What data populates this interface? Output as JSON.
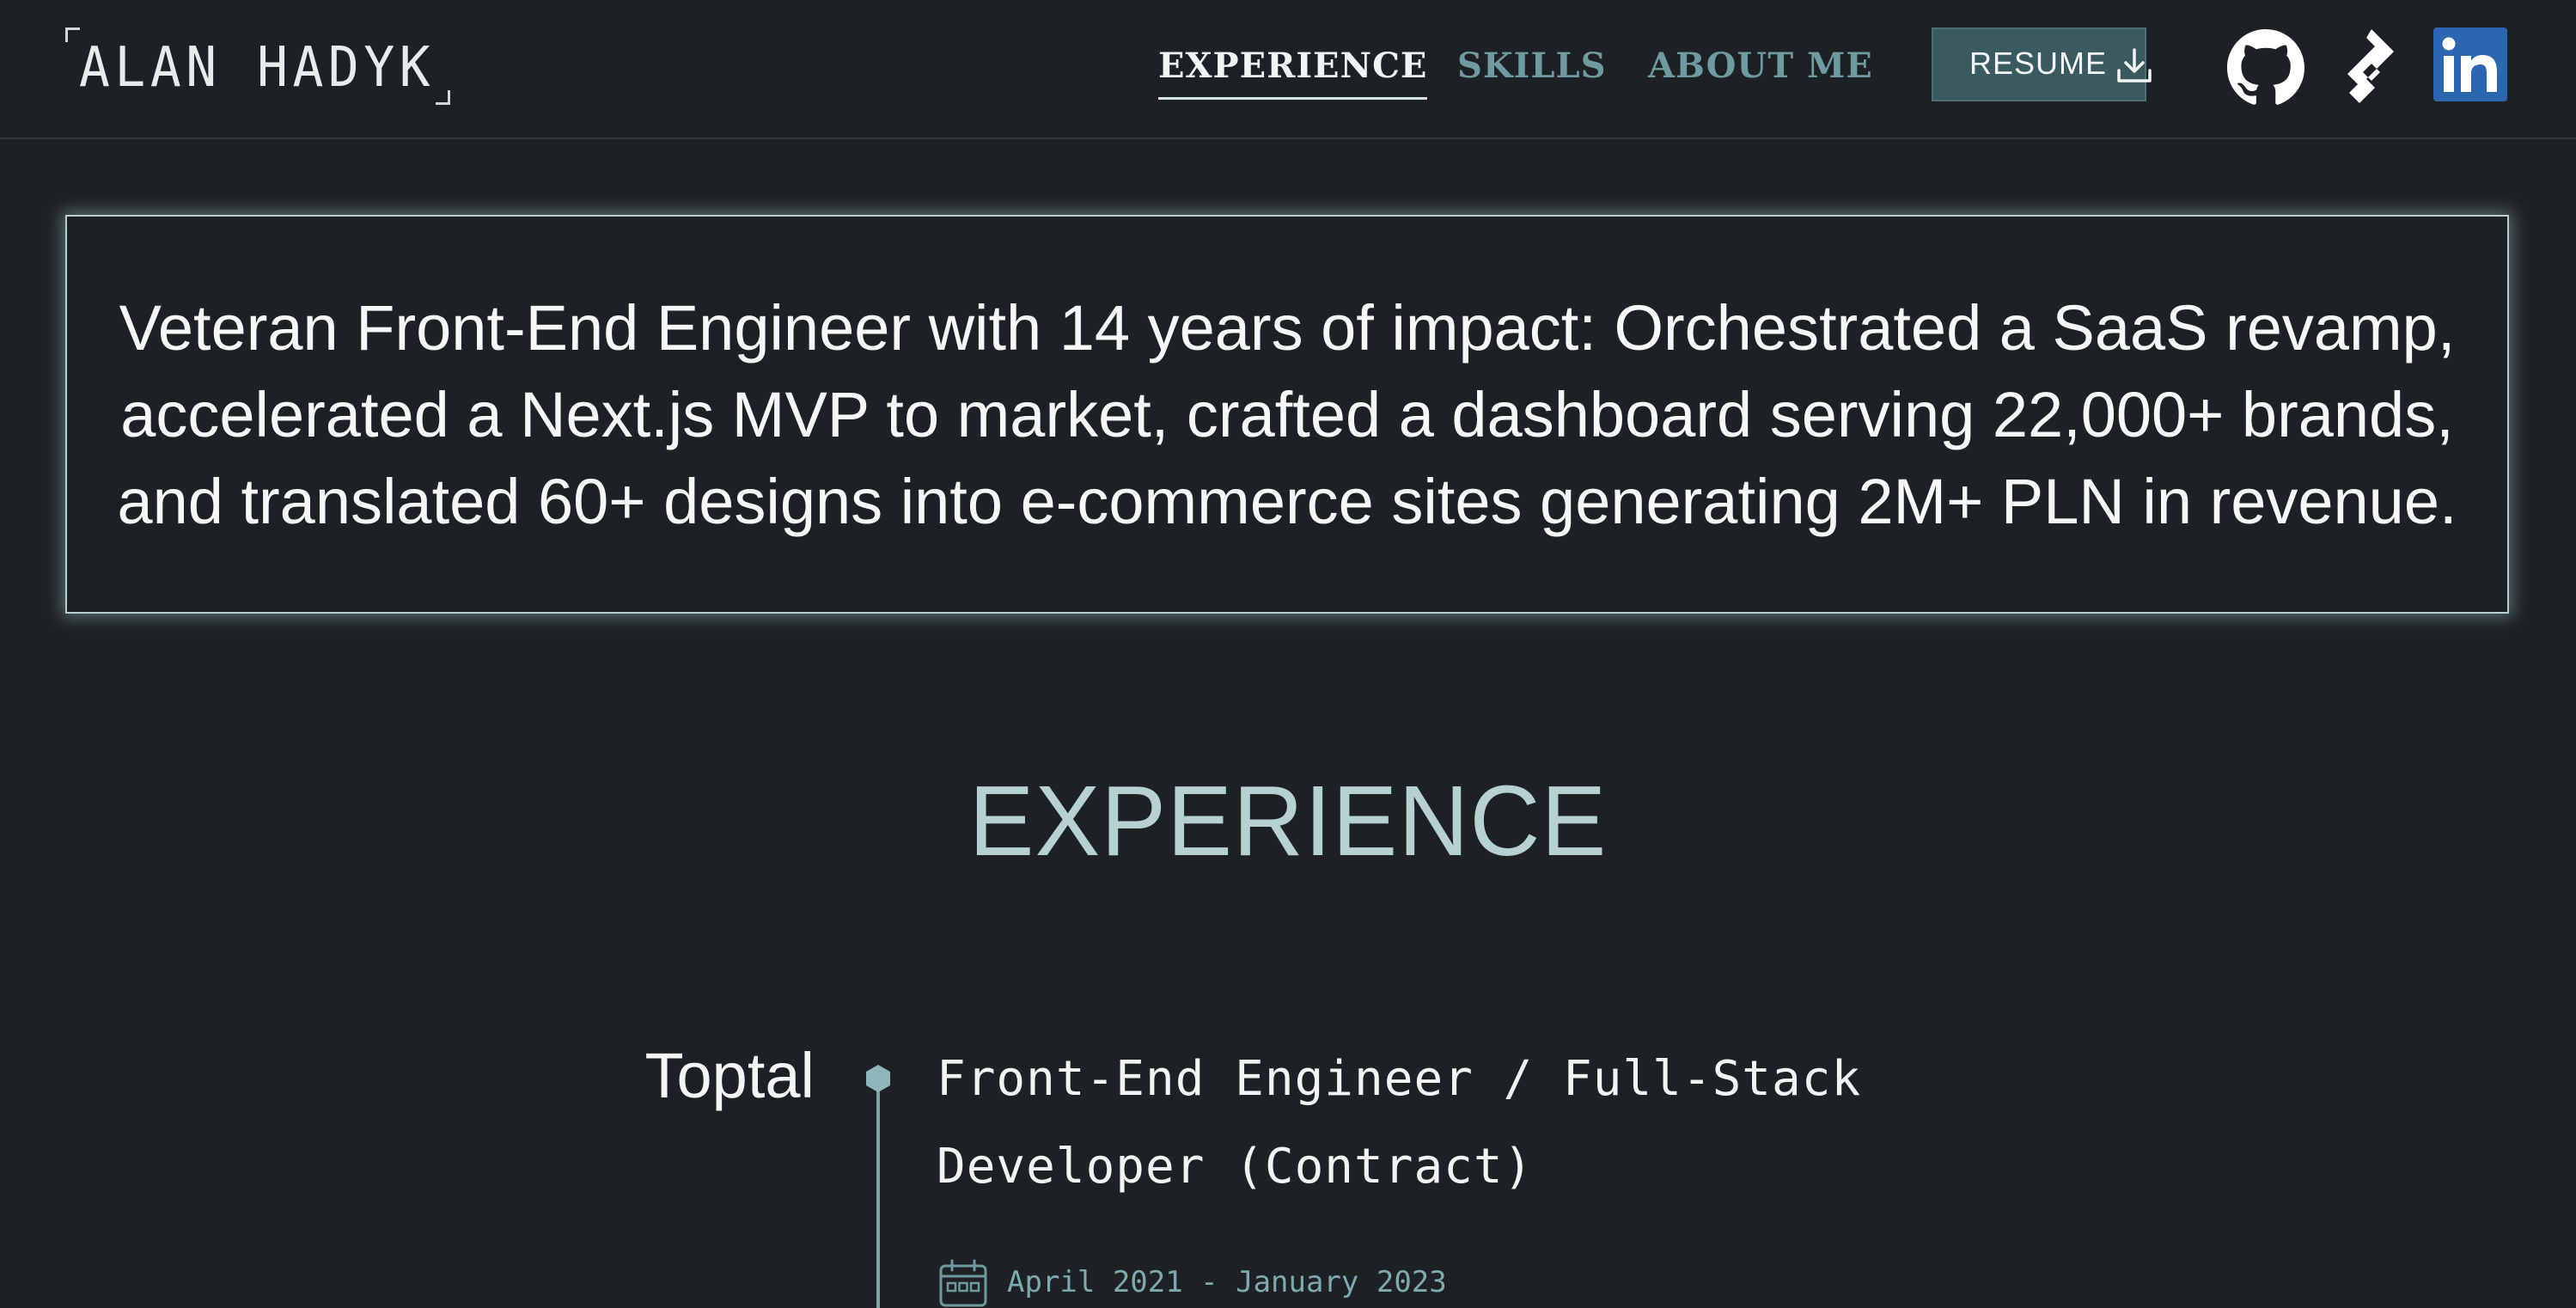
{
  "header": {
    "logo_text": "ALAN HADYK",
    "nav": [
      {
        "label": "EXPERIENCE",
        "active": true
      },
      {
        "label": "SKILLS",
        "active": false
      },
      {
        "label": "ABOUT ME",
        "active": false
      }
    ],
    "resume_label": "RESUME",
    "social_icons": [
      "github-icon",
      "toptal-icon",
      "linkedin-icon"
    ]
  },
  "hero": {
    "text": "Veteran Front-End Engineer with 14 years of impact: Orchestrated a SaaS revamp, accelerated a Next.js MVP to market, crafted a dashboard serving 22,000+ brands, and translated 60+ designs into e-commerce sites generating 2M+ PLN in revenue."
  },
  "experience": {
    "title": "EXPERIENCE",
    "entries": [
      {
        "company": "Toptal",
        "role": "Front-End Engineer / Full-Stack Developer (Contract)",
        "date": "April 2021 - January 2023"
      }
    ]
  },
  "colors": {
    "background": "#1e2124",
    "accent": "#3a5a60",
    "muted_link": "#6e9aa0",
    "title": "#b7d0d2",
    "linkedin": "#2c66b0"
  }
}
